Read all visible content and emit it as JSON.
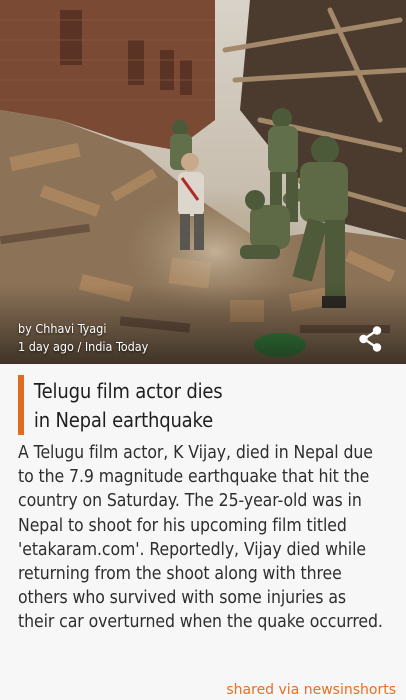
{
  "image": {
    "description": "earthquake-rubble-soldiers-photo"
  },
  "byline": {
    "author": "by Chhavi Tyagi",
    "meta": "1 day ago / India Today"
  },
  "icons": {
    "share": "share-icon"
  },
  "colors": {
    "accent": "#e06c1e",
    "footer_text": "#e8701f",
    "title_text": "#1f1f1f",
    "body_text": "#2e2e2e",
    "background": "#f7f7f7"
  },
  "article": {
    "title_line1": "Telugu film actor dies",
    "title_line2": "in Nepal earthquake",
    "body": "A Telugu film actor, K Vijay, died in Nepal due to the 7.9 magnitude earthquake that hit the country on Saturday. The 25-year-old was in Nepal to shoot for his upcoming film titled 'etakaram.com'. Reportedly, Vijay died while returning from the shoot along with three others who survived with some injuries as their car overturned when the quake occurred."
  },
  "footer": {
    "label": "shared via newsinshorts"
  }
}
